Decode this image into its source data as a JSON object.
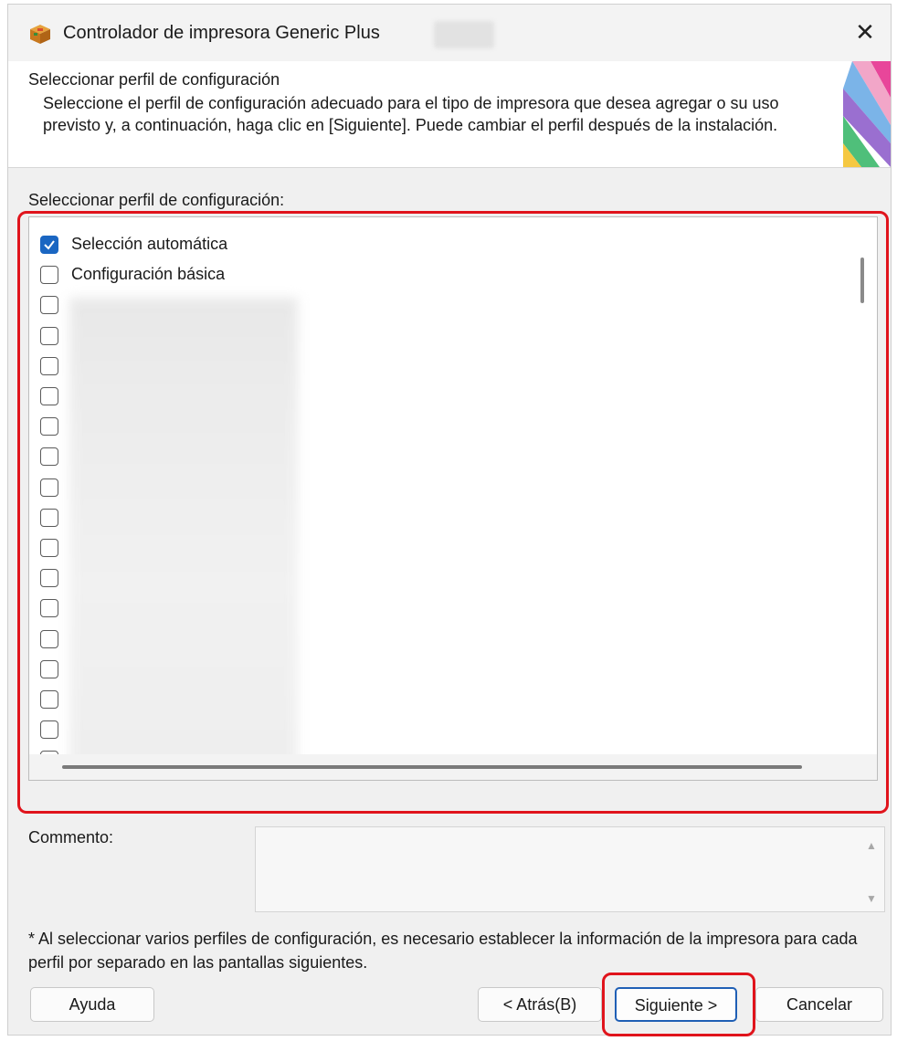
{
  "window": {
    "title": "Controlador de impresora Generic Plus",
    "close_glyph": "✕"
  },
  "header": {
    "title": "Seleccionar perfil de configuración",
    "description": "Seleccione el perfil de configuración adecuado para el tipo de impresora que desea agregar o su uso previsto y, a continuación, haga clic en [Siguiente]. Puede cambiar el perfil después de la instalación."
  },
  "profile_list": {
    "label": "Seleccionar perfil de configuración:",
    "items": [
      {
        "label": "Selección automática",
        "checked": true
      },
      {
        "label": "Configuración básica",
        "checked": false
      },
      {
        "label": "",
        "checked": false
      },
      {
        "label": "",
        "checked": false
      },
      {
        "label": "",
        "checked": false
      },
      {
        "label": "",
        "checked": false
      },
      {
        "label": "",
        "checked": false
      },
      {
        "label": "",
        "checked": false
      },
      {
        "label": "",
        "checked": false
      },
      {
        "label": "",
        "checked": false
      },
      {
        "label": "",
        "checked": false
      },
      {
        "label": "",
        "checked": false
      },
      {
        "label": "",
        "checked": false
      },
      {
        "label": "",
        "checked": false
      },
      {
        "label": "",
        "checked": false
      },
      {
        "label": "",
        "checked": false
      },
      {
        "label": "",
        "checked": false
      },
      {
        "label": "",
        "checked": false
      }
    ]
  },
  "comment": {
    "label": "Commento:",
    "value": ""
  },
  "note": "* Al seleccionar varios perfiles de configuración, es necesario establecer la información de la impresora para cada perfil por separado en las pantallas siguientes.",
  "buttons": {
    "help": "Ayuda",
    "back": "< Atrás(B)",
    "next": "Siguiente >",
    "cancel": "Cancelar"
  },
  "colors": {
    "highlight": "#e0141c",
    "checkbox_checked": "#1a66c2",
    "primary_border": "#1f5fb5"
  }
}
